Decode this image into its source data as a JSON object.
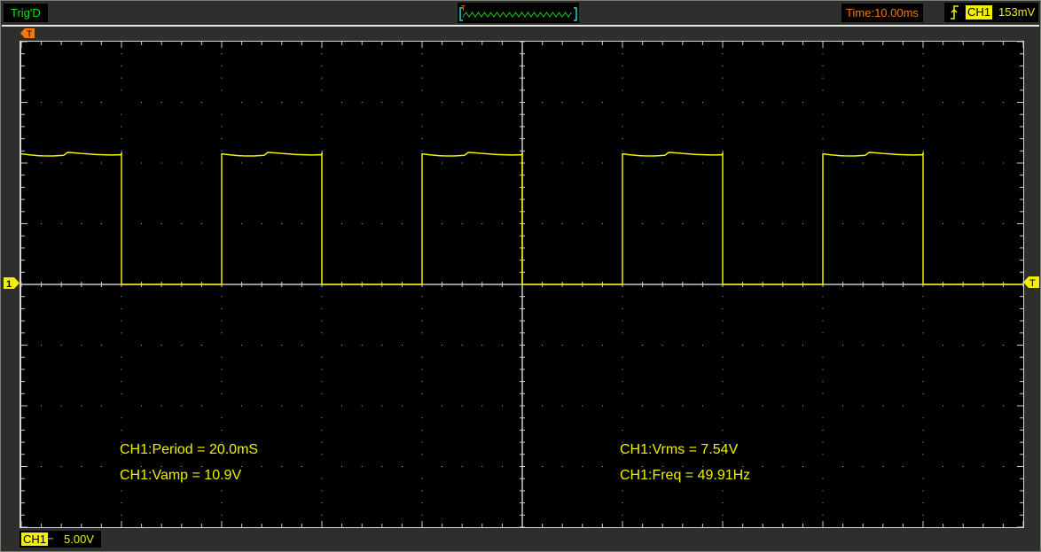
{
  "status": {
    "trigger_state": "Trig'D"
  },
  "timebase": {
    "label": "Time:10.00ms"
  },
  "trigger": {
    "channel": "CH1",
    "level": "153mV",
    "edge": "rising",
    "marker": "T"
  },
  "channel1": {
    "label": "CH1",
    "coupling_symbol": "⎓",
    "volts_per_div": "5.00V",
    "marker": "1",
    "color": "#f0f000"
  },
  "measurements": {
    "period": "CH1:Period = 20.0mS",
    "vamp": "CH1:Vamp = 10.9V",
    "vrms": "CH1:Vrms = 7.54V",
    "freq": "CH1:Freq = 49.91Hz"
  },
  "waveform": {
    "type": "square",
    "period_ms": 20.0,
    "high_v": 10.8,
    "low_v": 0,
    "ms_per_div": 10,
    "v_per_div": 5,
    "first_falling_edge_div": 1.0,
    "duty": 0.5
  }
}
